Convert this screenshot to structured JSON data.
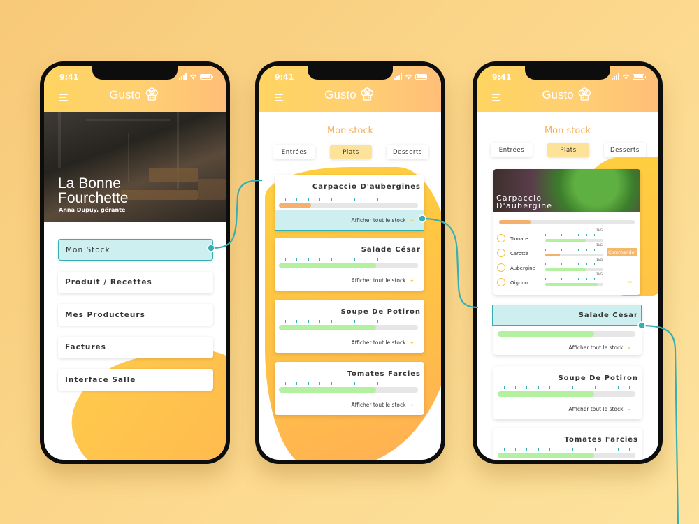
{
  "status_time": "9:41",
  "app_name": "Gusto",
  "colors": {
    "accent": "#ffd460",
    "highlight": "#cdeff0",
    "connector": "#39aeb0",
    "bar_green": "#b3f0a0",
    "bar_orange": "#f5b06e"
  },
  "home": {
    "restaurant_name_line1": "La Bonne",
    "restaurant_name_line2": "Fourchette",
    "manager": "Anna Dupuy, gérante",
    "menu": [
      {
        "label": "Mon Stock",
        "active": true
      },
      {
        "label": "Produit / Recettes"
      },
      {
        "label": "Mes Producteurs"
      },
      {
        "label": "Factures"
      },
      {
        "label": "Interface Salle"
      }
    ]
  },
  "stock": {
    "title": "Mon stock",
    "tabs": [
      "Entrées",
      "Plats",
      "Desserts"
    ],
    "active_tab": "Plats",
    "show_all": "Afficher tout le stock",
    "dishes": [
      {
        "name": "Carpaccio D'aubergines",
        "level": 0.23,
        "color": "#f5b06e"
      },
      {
        "name": "Salade César",
        "level": 0.7,
        "color": "#b3f0a0"
      },
      {
        "name": "Soupe De Potiron",
        "level": 0.7,
        "color": "#b3f0a0"
      },
      {
        "name": "Tomates Farcies",
        "level": 0.7,
        "color": "#b3f0a0"
      }
    ]
  },
  "detail": {
    "title_line1": "Carpaccio",
    "title_line2": "D'aubergine",
    "level": 0.23,
    "ingredients": [
      {
        "name": "Tomate",
        "level": 0.7,
        "max": "1kG",
        "color": "#b3f0a0"
      },
      {
        "name": "Carotte",
        "level": 0.25,
        "max": "1kG",
        "color": "#f5b06e"
      },
      {
        "name": "Aubergine",
        "level": 0.7,
        "max": "1kG",
        "color": "#b3f0a0"
      },
      {
        "name": "Oignon",
        "level": 0.9,
        "max": "1kG",
        "color": "#b3f0a0"
      }
    ],
    "order_button": "Commander"
  }
}
